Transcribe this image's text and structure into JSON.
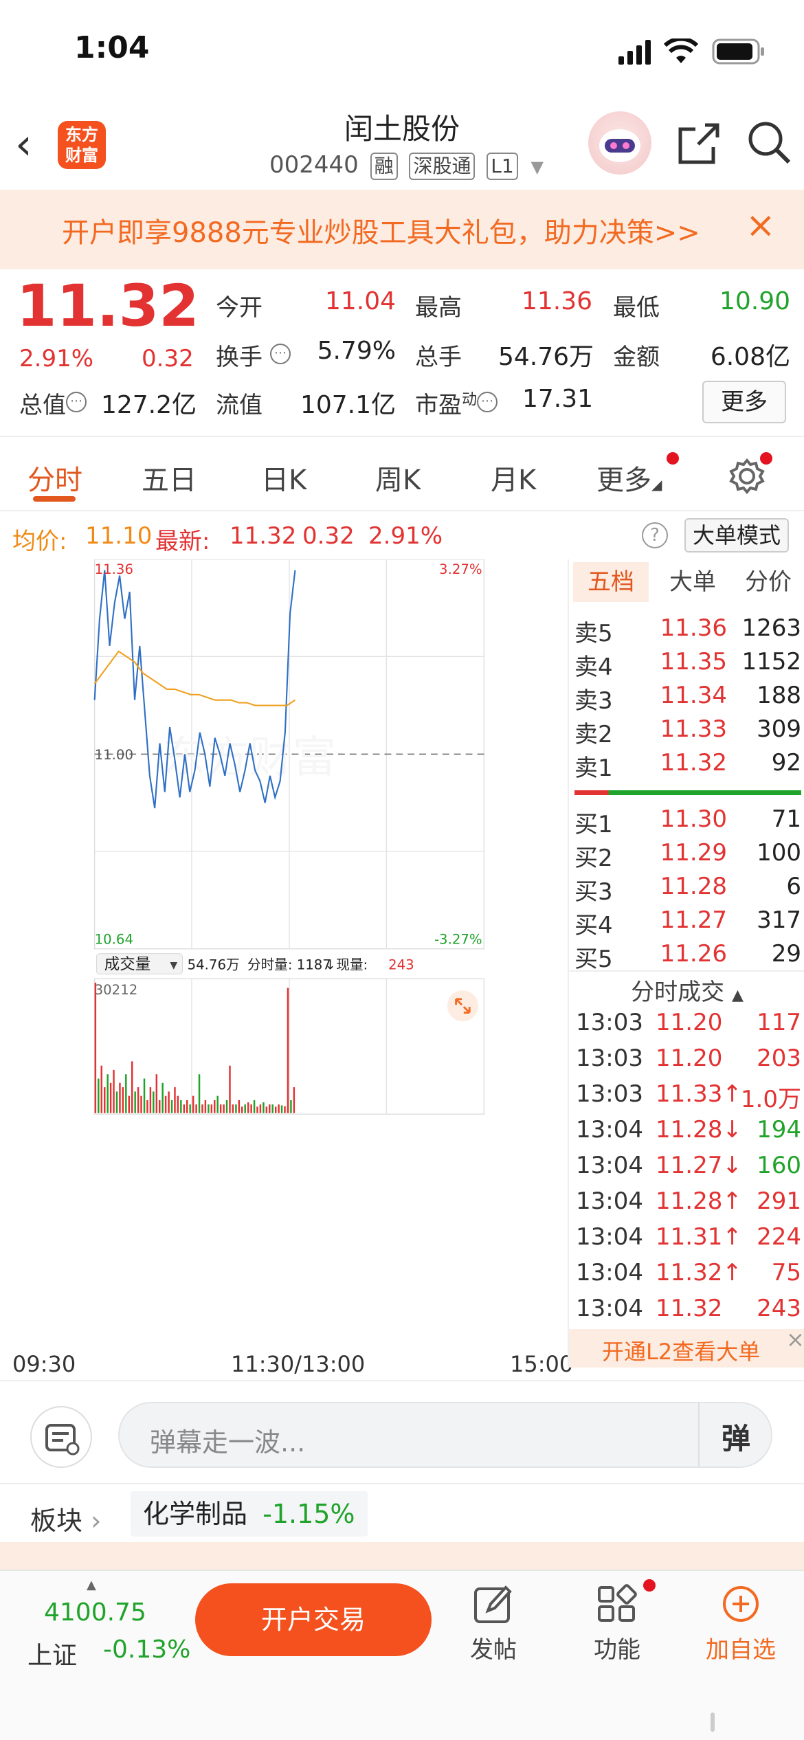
{
  "status": {
    "time": "1:04"
  },
  "header": {
    "logo_line1": "东方",
    "logo_line2": "财富",
    "stock_name": "闰土股份",
    "stock_code": "002440",
    "tags": [
      "融",
      "深股通",
      "L1"
    ]
  },
  "banner": {
    "text": "开户即享9888元专业炒股工具大礼包，助力决策>>"
  },
  "quote": {
    "price": "11.32",
    "change_pct": "2.91%",
    "change": "0.32",
    "fields": [
      {
        "label": "今开",
        "value": "11.04",
        "color": "red"
      },
      {
        "label": "最高",
        "value": "11.36",
        "color": "red"
      },
      {
        "label": "最低",
        "value": "10.90",
        "color": "green"
      },
      {
        "label": "换手",
        "value": "5.79%",
        "color": "black"
      },
      {
        "label": "总手",
        "value": "54.76万",
        "color": "black"
      },
      {
        "label": "金额",
        "value": "6.08亿",
        "color": "black"
      },
      {
        "label": "总值",
        "value": "127.2亿",
        "color": "black"
      },
      {
        "label": "流值",
        "value": "107.1亿",
        "color": "black"
      },
      {
        "label": "市盈",
        "value": "17.31",
        "color": "black"
      }
    ],
    "pe_sup": "动",
    "more_label": "更多"
  },
  "tabs": [
    "分时",
    "五日",
    "日K",
    "周K",
    "月K",
    "更多"
  ],
  "chart_info": {
    "avg_label": "均价:",
    "avg_value": "11.10",
    "latest_label": "最新:",
    "latest_value": "11.32",
    "latest_change": "0.32",
    "latest_pct": "2.91%",
    "mode_label": "大单模式"
  },
  "chart_data": {
    "type": "line",
    "y_max": "11.36",
    "y_min": "10.64",
    "y_ref": "11.00",
    "pct_max": "3.27%",
    "pct_min": "-3.27%",
    "x_labels": [
      "09:30",
      "11:30/13:00",
      "15:00"
    ],
    "series": [
      {
        "values": [
          11.1,
          11.25,
          11.34,
          11.2,
          11.28,
          11.33,
          11.25,
          11.3,
          11.1,
          11.2,
          11.08,
          10.96,
          10.9,
          11.02,
          10.93,
          11.05,
          10.99,
          10.92,
          11.0,
          10.93,
          10.97,
          11.04,
          11.0,
          10.94,
          11.03,
          11.0,
          10.96,
          11.02,
          10.98,
          10.93,
          10.97,
          11.02,
          10.97,
          10.95,
          10.91,
          10.96,
          10.92,
          10.95,
          11.04,
          11.26,
          11.34
        ],
        "color": "#2f6fc4"
      },
      {
        "values": [
          11.13,
          11.15,
          11.17,
          11.19,
          11.18,
          11.17,
          11.15,
          11.14,
          11.13,
          11.12,
          11.12,
          11.115,
          11.11,
          11.11,
          11.105,
          11.1,
          11.1,
          11.1,
          11.095,
          11.095,
          11.09,
          11.09,
          11.09,
          11.09,
          11.09,
          11.1
        ],
        "color": "#f0a020"
      }
    ],
    "volume": {
      "label": "成交量",
      "total": "54.76万",
      "tick_label": "分时量: 1187",
      "now_label": "现量:",
      "now_value": "243",
      "max": "30212",
      "values": [
        30212,
        8000,
        11000,
        6000,
        9000,
        7000,
        10000,
        5000,
        7000,
        6000,
        9000,
        4000,
        12000,
        5000,
        6000,
        4000,
        8000,
        3000,
        6000,
        5000,
        9000,
        3000,
        7000,
        4000,
        5000,
        3000,
        6000,
        4000,
        3000,
        2000,
        3000,
        2000,
        4000,
        2000,
        9000,
        2000,
        3000,
        2000,
        2000,
        3000,
        4000,
        2000,
        2000,
        3000,
        11000,
        2000,
        2000,
        3000,
        1500,
        2000,
        2500,
        2000,
        3000,
        1500,
        2000,
        2500,
        1500,
        2000,
        2000,
        1500,
        2000,
        1800,
        1600,
        29000,
        3000,
        6000
      ]
    }
  },
  "order_book": {
    "tabs": [
      "五档",
      "大单",
      "分价"
    ],
    "sell": [
      {
        "label": "卖5",
        "price": "11.36",
        "vol": "1263"
      },
      {
        "label": "卖4",
        "price": "11.35",
        "vol": "1152"
      },
      {
        "label": "卖3",
        "price": "11.34",
        "vol": "188"
      },
      {
        "label": "卖2",
        "price": "11.33",
        "vol": "309"
      },
      {
        "label": "卖1",
        "price": "11.32",
        "vol": "92"
      }
    ],
    "buy": [
      {
        "label": "买1",
        "price": "11.30",
        "vol": "71"
      },
      {
        "label": "买2",
        "price": "11.29",
        "vol": "100"
      },
      {
        "label": "买3",
        "price": "11.28",
        "vol": "6"
      },
      {
        "label": "买4",
        "price": "11.27",
        "vol": "317"
      },
      {
        "label": "买5",
        "price": "11.26",
        "vol": "29"
      }
    ],
    "trades_title": "分时成交",
    "trades": [
      {
        "time": "13:03",
        "price": "11.20",
        "vol": "117",
        "dir": ""
      },
      {
        "time": "13:03",
        "price": "11.20",
        "vol": "203",
        "dir": ""
      },
      {
        "time": "13:03",
        "price": "11.33↑",
        "vol": "1.0万",
        "dir": "up"
      },
      {
        "time": "13:04",
        "price": "11.28↓",
        "vol": "194",
        "dir": "down"
      },
      {
        "time": "13:04",
        "price": "11.27↓",
        "vol": "160",
        "dir": "down"
      },
      {
        "time": "13:04",
        "price": "11.28↑",
        "vol": "291",
        "dir": "up"
      },
      {
        "time": "13:04",
        "price": "11.31↑",
        "vol": "224",
        "dir": "up"
      },
      {
        "time": "13:04",
        "price": "11.32↑",
        "vol": "75",
        "dir": "up"
      },
      {
        "time": "13:04",
        "price": "11.32",
        "vol": "243",
        "dir": ""
      }
    ],
    "l2_label": "开通L2查看大单"
  },
  "comment": {
    "placeholder": "弹幕走一波...",
    "danmu": "弹"
  },
  "sector": {
    "label": "板块",
    "name": "化学制品",
    "pct": "-1.15%"
  },
  "bottom_bar": {
    "index_value": "4100.75",
    "index_name": "上证",
    "index_pct": "-0.13%",
    "open_trade": "开户交易",
    "post": "发帖",
    "function": "功能",
    "watch": "加自选"
  }
}
